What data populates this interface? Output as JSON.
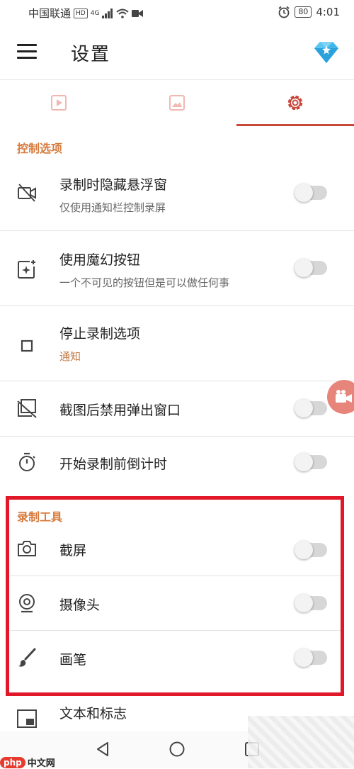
{
  "status_bar": {
    "carrier": "中国联通",
    "hd_label": "HD",
    "network": "4G",
    "battery": "80",
    "time": "4:01"
  },
  "app_bar": {
    "title": "设置"
  },
  "tabs": [
    {
      "icon": "video-icon",
      "selected": false
    },
    {
      "icon": "image-icon",
      "selected": false
    },
    {
      "icon": "gear-icon",
      "selected": true
    }
  ],
  "sections": {
    "control": "控制选项",
    "tools": "录制工具"
  },
  "rows": {
    "hide_overlay": {
      "title": "录制时隐藏悬浮窗",
      "subtitle": "仅使用通知栏控制录屏",
      "enabled": false
    },
    "magic_button": {
      "title": "使用魔幻按钮",
      "subtitle": "一个不可见的按钮但是可以做任何事",
      "enabled": false
    },
    "stop_options": {
      "title": "停止录制选项",
      "subtitle": "通知"
    },
    "disable_popup": {
      "title": "截图后禁用弹出窗口",
      "enabled": false
    },
    "countdown": {
      "title": "开始录制前倒计时",
      "enabled": false
    },
    "screenshot": {
      "title": "截屏",
      "enabled": false
    },
    "camera": {
      "title": "摄像头",
      "enabled": false
    },
    "brush": {
      "title": "画笔",
      "enabled": false
    },
    "text_logo": {
      "title": "文本和标志"
    }
  },
  "watermark": {
    "php": "php",
    "site": "中文网"
  },
  "colors": {
    "accent": "#c8463a",
    "section_header": "#d77a3c",
    "highlight": "#e0182a"
  }
}
